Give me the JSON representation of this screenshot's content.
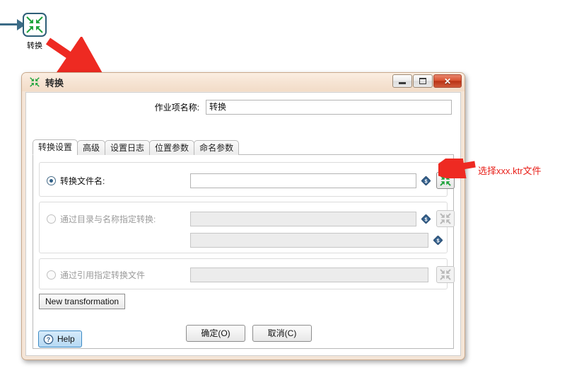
{
  "canvas": {
    "node_label": "转换",
    "node_icon": "transformation-icon",
    "hop_icon": "hop-arrow-icon"
  },
  "annotations": [
    {
      "id": "arrow-to-dialog",
      "icon": "red-arrow-icon",
      "text": ""
    },
    {
      "id": "arrow-to-browse",
      "icon": "red-arrow-icon",
      "text": "选择xxx.ktr文件"
    }
  ],
  "dialog": {
    "title": "转换",
    "title_icon": "transformation-icon",
    "window_controls": {
      "minimize": "minimize-icon",
      "maximize": "maximize-icon",
      "close": "✕"
    },
    "jobname": {
      "label": "作业项名称:",
      "value": "转换",
      "placeholder": ""
    },
    "tabs": [
      {
        "label": "转换设置",
        "selected": true
      },
      {
        "label": "高级",
        "selected": false
      },
      {
        "label": "设置日志",
        "selected": false
      },
      {
        "label": "位置参数",
        "selected": false
      },
      {
        "label": "命名参数",
        "selected": false
      }
    ],
    "groups": {
      "by_filename": {
        "radio_label": "转换文件名:",
        "selected": true,
        "enabled": true,
        "field_value": "",
        "variable_icon": "variable-dollar-icon",
        "browse_icon": "transformation-icon"
      },
      "by_directory": {
        "radio_label": "通过目录与名称指定转换:",
        "selected": false,
        "enabled": false,
        "field_value": "",
        "field2_value": "",
        "variable_icon": "variable-dollar-icon",
        "browse_icon": "transformation-icon"
      },
      "by_reference": {
        "radio_label": "通过引用指定转换文件",
        "selected": false,
        "enabled": false,
        "field_value": "",
        "browse_icon": "transformation-icon"
      }
    },
    "new_transformation_label": "New transformation",
    "buttons": {
      "help": "Help",
      "help_icon": "question-mark-icon",
      "ok": "确定(O)",
      "cancel": "取消(C)"
    }
  },
  "colors": {
    "annotation_red": "#e8201a",
    "title_bar": "#f6e3d2",
    "node_border": "#2e5f78",
    "transform_green": "#1ea33c"
  }
}
